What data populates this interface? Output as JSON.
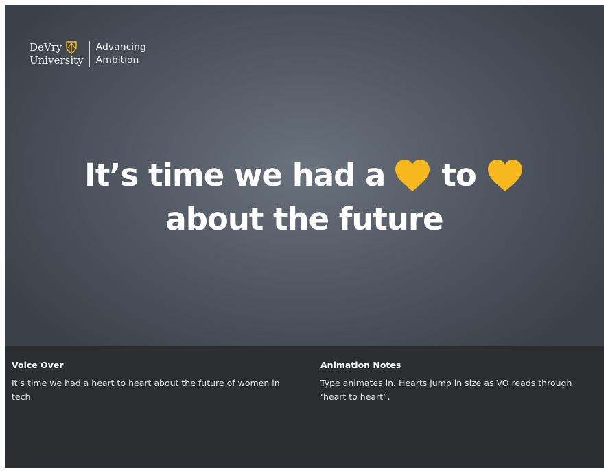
{
  "logo": {
    "line1": "DeVry",
    "line2": "University",
    "tagline_line1": "Advancing",
    "tagline_line2": "Ambition",
    "accent_color": "#f6b81c"
  },
  "headline": {
    "line1_before": "It’s time we had a",
    "line1_middle": "to",
    "line2": "about the future",
    "heart_icon": "heart-icon",
    "heart_color": "#f6b81c"
  },
  "voice_over": {
    "title": "Voice Over",
    "text": "It’s time we had a heart to heart about the future of women in tech."
  },
  "animation_notes": {
    "title": "Animation Notes",
    "text": "Type animates in. Hearts jump in size as VO reads through ‘heart to heart”."
  }
}
